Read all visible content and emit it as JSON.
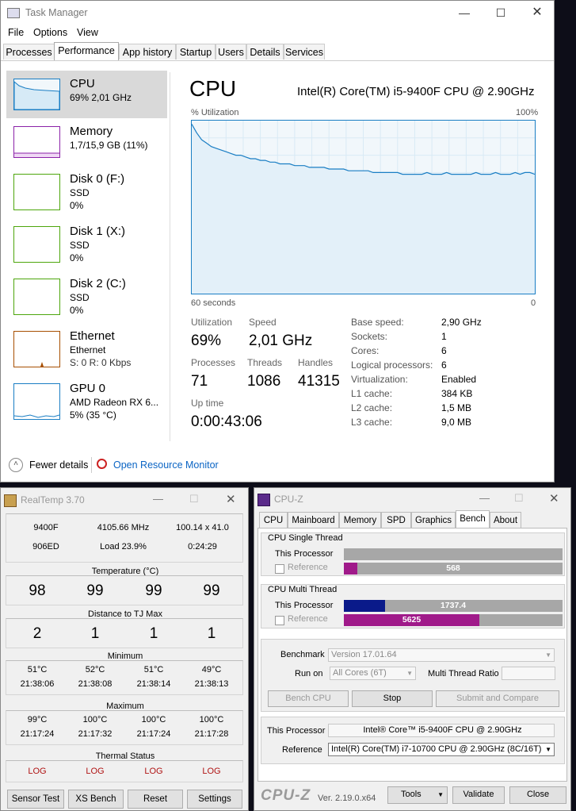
{
  "taskmgr": {
    "title": "Task Manager",
    "menu": [
      "File",
      "Options",
      "View"
    ],
    "tabs": [
      "Processes",
      "Performance",
      "App history",
      "Startup",
      "Users",
      "Details",
      "Services"
    ],
    "active_tab": "Performance",
    "sidebar": [
      {
        "name": "CPU",
        "l2": "69% 2,01 GHz",
        "l3": "",
        "color": "#1a7ec4"
      },
      {
        "name": "Memory",
        "l2": "1,7/15,9 GB (11%)",
        "l3": "",
        "color": "#8b22a8"
      },
      {
        "name": "Disk 0 (F:)",
        "l2": "SSD",
        "l3": "0%",
        "color": "#4da60c"
      },
      {
        "name": "Disk 1 (X:)",
        "l2": "SSD",
        "l3": "0%",
        "color": "#4da60c"
      },
      {
        "name": "Disk 2 (C:)",
        "l2": "SSD",
        "l3": "0%",
        "color": "#4da60c"
      },
      {
        "name": "Ethernet",
        "l2": "Ethernet",
        "l3": "S: 0 R: 0 Kbps",
        "color": "#a74f01"
      },
      {
        "name": "GPU 0",
        "l2": "AMD Radeon RX 6...",
        "l3": "5% (35 °C)",
        "color": "#1a7ec4"
      }
    ],
    "main": {
      "title": "CPU",
      "model": "Intel(R) Core(TM) i5-9400F CPU @ 2.90GHz",
      "graph_label": "% Utilization",
      "graph_max": "100%",
      "graph_time": "60 seconds",
      "graph_min": "0",
      "utilization_history": [
        98,
        93,
        89,
        87,
        85,
        84,
        83,
        82,
        81,
        80,
        80,
        79,
        78,
        78,
        77,
        77,
        76,
        76,
        75,
        75,
        75,
        74,
        74,
        74,
        73,
        73,
        73,
        73,
        72,
        72,
        72,
        72,
        71,
        71,
        71,
        71,
        71,
        70,
        70,
        70,
        70,
        70,
        70,
        69,
        69,
        69,
        69,
        69,
        70,
        69,
        69,
        69,
        70,
        69,
        69,
        69,
        69,
        69,
        70,
        69,
        69,
        69,
        70,
        69,
        69,
        69,
        70,
        69,
        70,
        70,
        69
      ]
    },
    "stats": {
      "utilization_label": "Utilization",
      "utilization": "69%",
      "speed_label": "Speed",
      "speed": "2,01 GHz",
      "processes_label": "Processes",
      "processes": "71",
      "threads_label": "Threads",
      "threads": "1086",
      "handles_label": "Handles",
      "handles": "41315",
      "uptime_label": "Up time",
      "uptime": "0:00:43:06"
    },
    "specs": [
      {
        "label": "Base speed:",
        "value": "2,90 GHz"
      },
      {
        "label": "Sockets:",
        "value": "1"
      },
      {
        "label": "Cores:",
        "value": "6"
      },
      {
        "label": "Logical processors:",
        "value": "6"
      },
      {
        "label": "Virtualization:",
        "value": "Enabled"
      },
      {
        "label": "L1 cache:",
        "value": "384 KB"
      },
      {
        "label": "L2 cache:",
        "value": "1,5 MB"
      },
      {
        "label": "L3 cache:",
        "value": "9,0 MB"
      }
    ],
    "footer": {
      "fewer": "Fewer details",
      "monitor": "Open Resource Monitor"
    }
  },
  "realtemp": {
    "title": "RealTemp 3.70",
    "info": {
      "cpu": "9400F",
      "mhz": "4105.66 MHz",
      "mult": "100.14 x 41.0",
      "stepping": "906ED",
      "load": "Load  23.9%",
      "time": "0:24:29"
    },
    "temp_label": "Temperature (°C)",
    "temps": [
      "98",
      "99",
      "99",
      "99"
    ],
    "dist_label": "Distance to TJ Max",
    "dist": [
      "2",
      "1",
      "1",
      "1"
    ],
    "min_label": "Minimum",
    "min": [
      {
        "t": "51°C",
        "time": "21:38:06"
      },
      {
        "t": "52°C",
        "time": "21:38:08"
      },
      {
        "t": "51°C",
        "time": "21:38:14"
      },
      {
        "t": "49°C",
        "time": "21:38:13"
      }
    ],
    "max_label": "Maximum",
    "max": [
      {
        "t": "99°C",
        "time": "21:17:24"
      },
      {
        "t": "100°C",
        "time": "21:17:32"
      },
      {
        "t": "100°C",
        "time": "21:17:24"
      },
      {
        "t": "100°C",
        "time": "21:17:28"
      }
    ],
    "thermal_label": "Thermal Status",
    "thermal": [
      "LOG",
      "LOG",
      "LOG",
      "LOG"
    ],
    "buttons": [
      "Sensor Test",
      "XS Bench",
      "Reset",
      "Settings"
    ]
  },
  "cpuz": {
    "title": "CPU-Z",
    "tabs": [
      "CPU",
      "Mainboard",
      "Memory",
      "SPD",
      "Graphics",
      "Bench",
      "About"
    ],
    "active_tab": "Bench",
    "single": {
      "label": "CPU Single Thread",
      "this": "This Processor",
      "ref": "Reference",
      "this_fraction": 0.0,
      "ref_value": "568",
      "ref_fraction": 0.06
    },
    "multi": {
      "label": "CPU Multi Thread",
      "this": "This Processor",
      "ref": "Reference",
      "this_value": "1737.4",
      "this_fraction": 0.19,
      "ref_value": "5625",
      "ref_fraction": 0.62
    },
    "bench": {
      "benchmark_label": "Benchmark",
      "benchmark": "Version 17.01.64",
      "runon_label": "Run on",
      "runon": "All Cores (6T)",
      "ratio_label": "Multi Thread Ratio",
      "ratio": ""
    },
    "buttons": {
      "bench_cpu": "Bench CPU",
      "stop": "Stop",
      "submit": "Submit and Compare"
    },
    "proc": {
      "this_label": "This Processor",
      "this": "Intel® Core™ i5-9400F CPU @ 2.90GHz",
      "ref_label": "Reference",
      "ref": "Intel(R) Core(TM) i7-10700 CPU @ 2.90GHz (8C/16T)"
    },
    "footer": {
      "logo": "CPU-Z",
      "version": "Ver. 2.19.0.x64",
      "tools": "Tools",
      "validate": "Validate",
      "close": "Close"
    }
  }
}
